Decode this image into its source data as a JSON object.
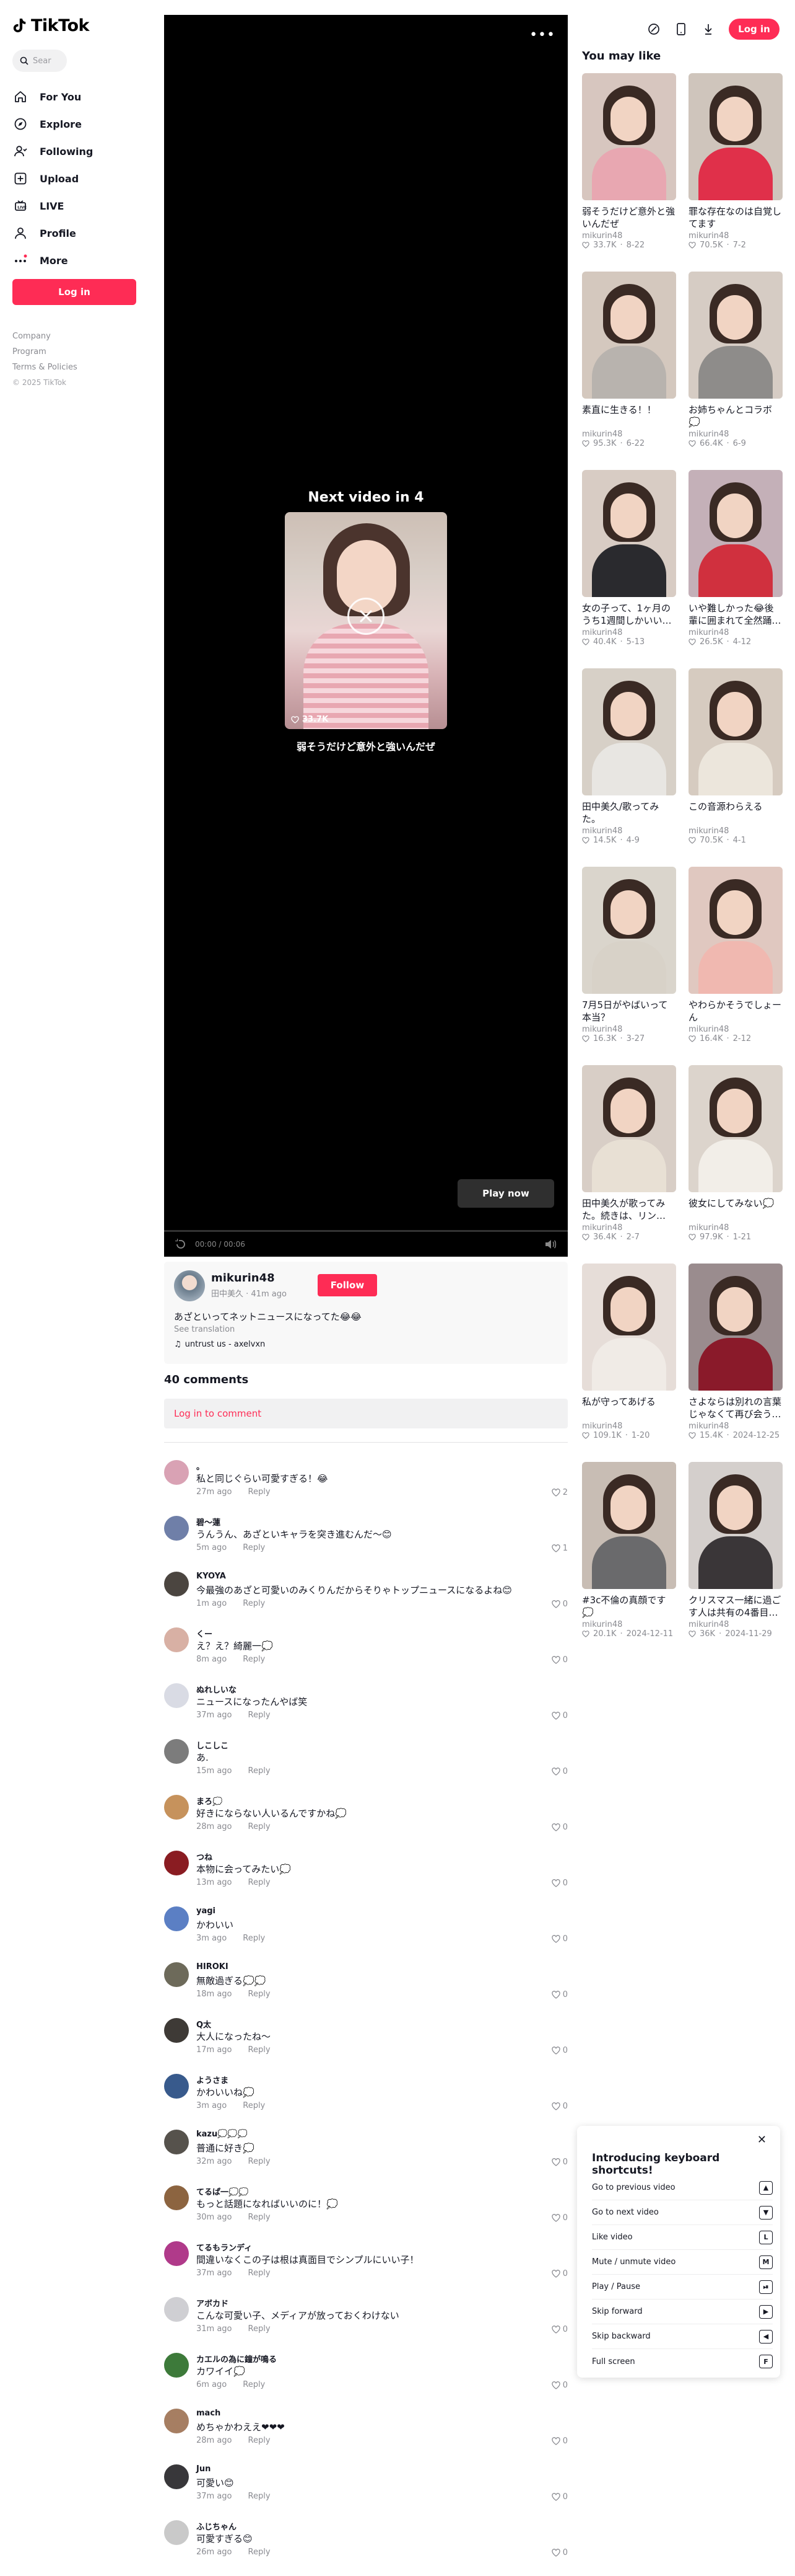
{
  "brand": {
    "name": "TikTok"
  },
  "search": {
    "placeholder": "Sear"
  },
  "nav": [
    {
      "label": "For You",
      "icon": "home-icon"
    },
    {
      "label": "Explore",
      "icon": "compass-icon"
    },
    {
      "label": "Following",
      "icon": "following-icon"
    },
    {
      "label": "Upload",
      "icon": "upload-icon"
    },
    {
      "label": "LIVE",
      "icon": "live-icon"
    },
    {
      "label": "Profile",
      "icon": "profile-icon"
    },
    {
      "label": "More",
      "icon": "more-icon"
    }
  ],
  "sidebar": {
    "login_label": "Log in"
  },
  "footer": {
    "company": "Company",
    "program": "Program",
    "terms": "Terms & Policies",
    "copyright": "© 2025 TikTok"
  },
  "topbar": {
    "login_label": "Log in"
  },
  "player": {
    "next_title": "Next video in 4",
    "next_likes": "33.7K",
    "next_caption": "弱そうだけど意外と強いんだぜ",
    "play_now": "Play now",
    "time": "00:00 / 00:06",
    "progress": 0
  },
  "author": {
    "name": "mikurin48",
    "sub": "田中美久 · 41m ago",
    "follow_label": "Follow",
    "description": "あざといってネットニュースになってた😂😂",
    "see_translation": "See translation",
    "music": "untrust us - axelvxn"
  },
  "comments_section": {
    "count_label": "40 comments",
    "login_prompt": "Log in to comment"
  },
  "comments": [
    {
      "user": "。",
      "text": "私と同じぐらい可愛すぎる！😂",
      "time": "27m ago",
      "reply": "Reply",
      "likes": "2",
      "color": "#d9a2b4"
    },
    {
      "user": "碧～蓮",
      "text": "うんうん、あざといキャラを突き進むんだ～😊",
      "time": "5m ago",
      "reply": "Reply",
      "likes": "1",
      "color": "#6f7fa8"
    },
    {
      "user": "KYOYA",
      "text": "今最強のあざと可愛いのみくりんだからそりゃトップニュースになるよね😊",
      "time": "1m ago",
      "reply": "Reply",
      "likes": "0",
      "color": "#4b4540"
    },
    {
      "user": "くー",
      "text": "え？え？綺麗一💭",
      "time": "8m ago",
      "reply": "Reply",
      "likes": "0",
      "color": "#d8b0a4"
    },
    {
      "user": "ぬれしいな",
      "text": "ニュースになったんやば笑",
      "time": "37m ago",
      "reply": "Reply",
      "likes": "0",
      "color": "#d9dbe4"
    },
    {
      "user": "しこしこ",
      "text": "あ.",
      "time": "15m ago",
      "reply": "Reply",
      "likes": "0",
      "color": "#7c7c7c"
    },
    {
      "user": "まろ💭",
      "text": "好きにならない人いるんですかね💭",
      "time": "28m ago",
      "reply": "Reply",
      "likes": "0",
      "color": "#c6925c"
    },
    {
      "user": "つね",
      "text": "本物に会ってみたい💭",
      "time": "13m ago",
      "reply": "Reply",
      "likes": "0",
      "color": "#8a1c22"
    },
    {
      "user": "yagi",
      "text": "かわいい",
      "time": "3m ago",
      "reply": "Reply",
      "likes": "0",
      "color": "#5b7fc4"
    },
    {
      "user": "HIROKI",
      "text": "無敵過ぎる💭💭",
      "time": "18m ago",
      "reply": "Reply",
      "likes": "0",
      "color": "#6d6a5a"
    },
    {
      "user": "Q太",
      "text": "大人になったね～",
      "time": "17m ago",
      "reply": "Reply",
      "likes": "0",
      "color": "#3e3a36"
    },
    {
      "user": "ようさま",
      "text": "かわいいね💭",
      "time": "3m ago",
      "reply": "Reply",
      "likes": "0",
      "color": "#385a8c"
    },
    {
      "user": "kazu💭💭💭",
      "text": "普通に好き💭",
      "time": "32m ago",
      "reply": "Reply",
      "likes": "0",
      "color": "#56524c"
    },
    {
      "user": "てるぱ一💭💭",
      "text": "もっと話題になればいいのに！💭",
      "time": "30m ago",
      "reply": "Reply",
      "likes": "0",
      "color": "#8c6440"
    },
    {
      "user": "てるもランディ",
      "text": "間違いなくこの子は根は真面目でシンプルにいい子！",
      "time": "37m ago",
      "reply": "Reply",
      "likes": "0",
      "color": "#b03a8a"
    },
    {
      "user": "アボカド",
      "text": "こんな可愛い子、メディアが放っておくわけない",
      "time": "31m ago",
      "reply": "Reply",
      "likes": "0",
      "color": "#cfcfd3"
    },
    {
      "user": "カエルの為に鐘が鳴る",
      "text": "カワイイ💭",
      "time": "6m ago",
      "reply": "Reply",
      "likes": "0",
      "color": "#3d7a3a"
    },
    {
      "user": "mach",
      "text": "めちゃかわええ❤❤❤",
      "time": "28m ago",
      "reply": "Reply",
      "likes": "0",
      "color": "#a67e62"
    },
    {
      "user": "Jun",
      "text": "可愛い😊",
      "time": "37m ago",
      "reply": "Reply",
      "likes": "0",
      "color": "#38373a"
    },
    {
      "user": "ふじちゃん",
      "text": "可愛すぎる😊",
      "time": "26m ago",
      "reply": "Reply",
      "likes": "0",
      "color": "#c9c9c9"
    }
  ],
  "recommendations": {
    "title": "You may like",
    "items": [
      {
        "title": "弱そうだけど意外と強いんだぜ",
        "user": "mikurin48",
        "likes": "33.7K",
        "date": "8-22",
        "bg": "#d7c6bf",
        "body": "#e8a7b1"
      },
      {
        "title": "罪な存在なのは自覚してます",
        "user": "mikurin48",
        "likes": "70.5K",
        "date": "7-2",
        "bg": "#cfc5bc",
        "body": "#e0304a"
      },
      {
        "title": "素直に生きる！！",
        "user": "mikurin48",
        "likes": "95.3K",
        "date": "6-22",
        "bg": "#d4c8be",
        "body": "#b8b3ae"
      },
      {
        "title": "お姉ちゃんとコラボ💭",
        "user": "mikurin48",
        "likes": "66.4K",
        "date": "6-9",
        "bg": "#d6ccc4",
        "body": "#8e8c8a"
      },
      {
        "title": "女の子って、1ヶ月のうち1週間しかいい…",
        "user": "mikurin48",
        "likes": "40.4K",
        "date": "5-13",
        "bg": "#d8ccc4",
        "body": "#2a2a2e"
      },
      {
        "title": "いや難しかった😂後輩に囲まれて全然踊…",
        "user": "mikurin48",
        "likes": "26.5K",
        "date": "4-12",
        "bg": "#c4b0b8",
        "body": "#d0303e"
      },
      {
        "title": "田中美久/歌ってみた。",
        "user": "mikurin48",
        "likes": "14.5K",
        "date": "4-9",
        "bg": "#d7d0c7",
        "body": "#e8e6e2"
      },
      {
        "title": "この音源わらえる",
        "user": "mikurin48",
        "likes": "70.5K",
        "date": "4-1",
        "bg": "#d6cbc0",
        "body": "#ece6dc"
      },
      {
        "title": "7月5日がやばいって本当？",
        "user": "mikurin48",
        "likes": "16.3K",
        "date": "3-27",
        "bg": "#dad5cc",
        "body": "#d8d2c8"
      },
      {
        "title": "やわらかそうでしょーん",
        "user": "mikurin48",
        "likes": "16.4K",
        "date": "2-12",
        "bg": "#e0c8c0",
        "body": "#f0b8b0"
      },
      {
        "title": "田中美久が歌ってみた。続きは、リン…",
        "user": "mikurin48",
        "likes": "36.4K",
        "date": "2-7",
        "bg": "#d8cec6",
        "body": "#e8e0d4"
      },
      {
        "title": "彼女にしてみない💭",
        "user": "mikurin48",
        "likes": "97.9K",
        "date": "1-21",
        "bg": "#dcd4cc",
        "body": "#f2eee8"
      },
      {
        "title": "私が守ってあげる",
        "user": "mikurin48",
        "likes": "109.1K",
        "date": "1-20",
        "bg": "#e6ddd8",
        "body": "#f0ebe6"
      },
      {
        "title": "さよならは別れの言葉じゃなくて再び会う…",
        "user": "mikurin48",
        "likes": "15.4K",
        "date": "2024-12-25",
        "bg": "#9a8c8e",
        "body": "#8a1a2a"
      },
      {
        "title": "#3c不倫の真顔です💭",
        "user": "mikurin48",
        "likes": "20.1K",
        "date": "2024-12-11",
        "bg": "#c8bdb4",
        "body": "#6a6a6c"
      },
      {
        "title": "クリスマス一緒に過ごす人は共有の4番目…",
        "user": "mikurin48",
        "likes": "36K",
        "date": "2024-11-29",
        "bg": "#d4cfcc",
        "body": "#3a3638"
      }
    ]
  },
  "shortcuts": {
    "title": "Introducing keyboard shortcuts!",
    "items": [
      {
        "label": "Go to previous video",
        "key": "▲"
      },
      {
        "label": "Go to next video",
        "key": "▼"
      },
      {
        "label": "Like video",
        "key": "L"
      },
      {
        "label": "Mute / unmute video",
        "key": "M"
      },
      {
        "label": "Play / Pause",
        "key": "⏯"
      },
      {
        "label": "Skip forward",
        "key": "▶"
      },
      {
        "label": "Skip backward",
        "key": "◀"
      },
      {
        "label": "Full screen",
        "key": "F"
      }
    ]
  }
}
